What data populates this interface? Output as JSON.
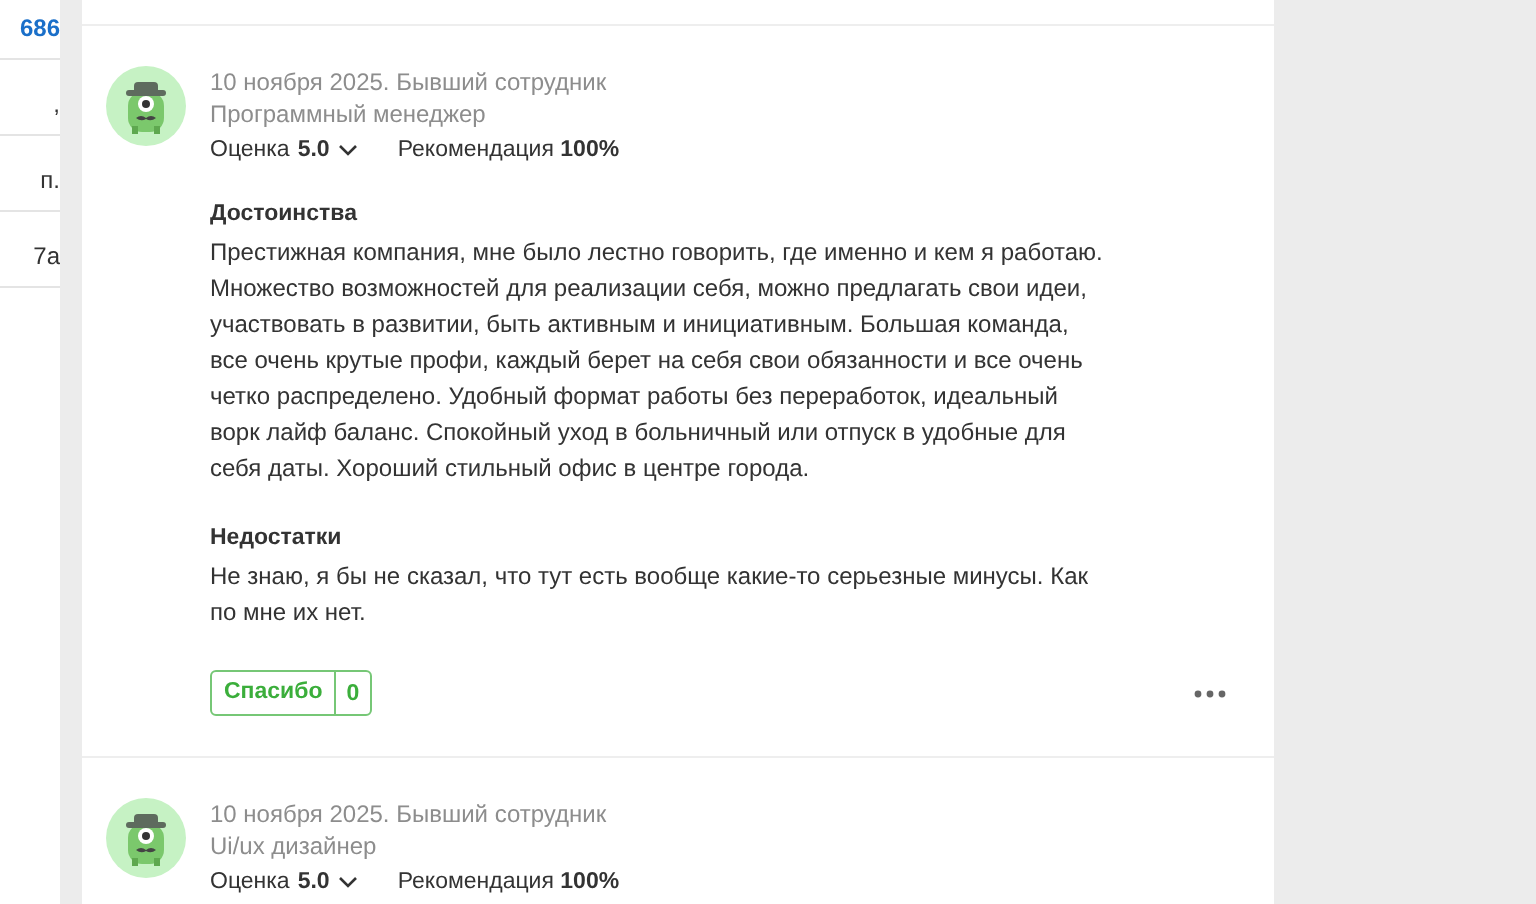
{
  "sidebar": {
    "fragments": [
      {
        "text": "686",
        "kind": "link"
      },
      {
        "text": ",",
        "kind": "plain"
      },
      {
        "text": "п.",
        "kind": "plain"
      },
      {
        "text": "7а",
        "kind": "plain"
      }
    ]
  },
  "reviews": [
    {
      "meta": "10 ноября 2025. Бывший сотрудник",
      "role": "Программный менеджер",
      "rating_label": "Оценка",
      "rating": "5.0",
      "recommend_label": "Рекомендация",
      "recommend": "100%",
      "sections": [
        {
          "title": "Достоинства",
          "text": "Престижная компания, мне было лестно говорить, где именно и кем я работаю. Множество возможностей для реализации себя, можно предлагать свои идеи, участвовать в развитии, быть активным и инициативным. Большая команда, все очень крутые профи, каждый берет на себя свои обязанности и все очень четко распределено. Удобный формат работы без переработок, идеальный ворк лайф баланс. Спокойный уход в больничный или отпуск в удобные для себя даты. Хороший стильный офис в центре города."
        },
        {
          "title": "Недостатки",
          "text": "Не знаю, я бы не сказал, что тут есть вообще какие-то серьезные минусы. Как по мне их нет."
        }
      ],
      "thanks": {
        "label": "Спасибо",
        "count": "0"
      }
    },
    {
      "meta": "10 ноября 2025. Бывший сотрудник",
      "role": "Ui/ux дизайнер",
      "rating_label": "Оценка",
      "rating": "5.0",
      "recommend_label": "Рекомендация",
      "recommend": "100%"
    }
  ]
}
